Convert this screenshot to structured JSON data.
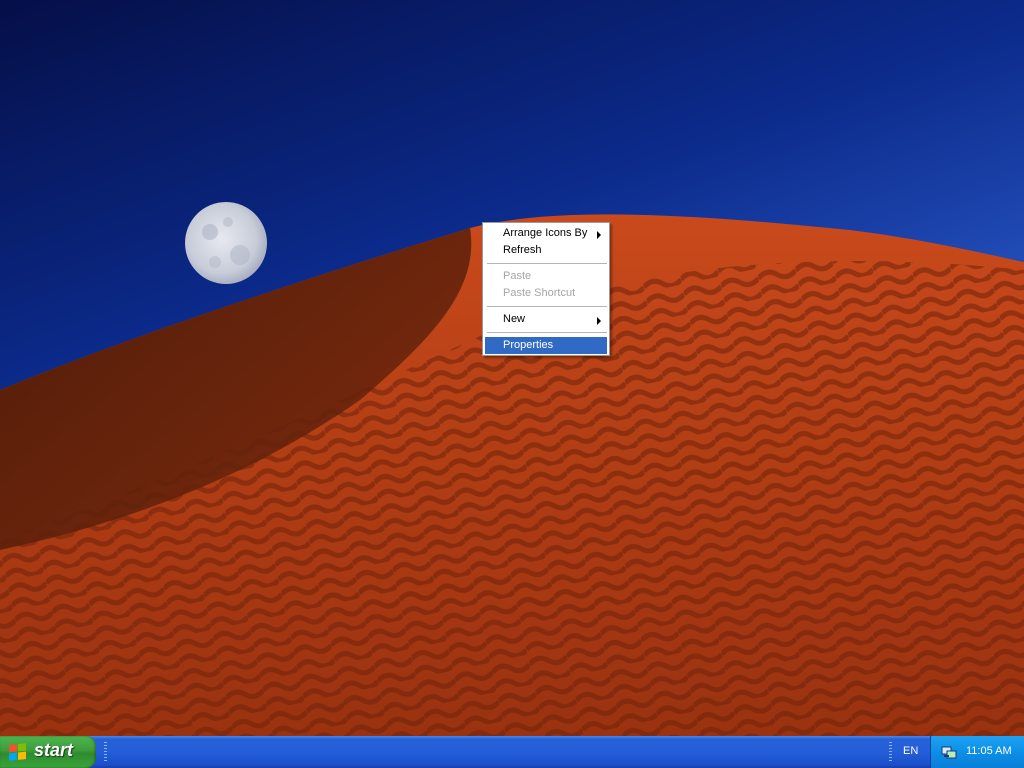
{
  "context_menu": {
    "items": [
      {
        "label": "Arrange Icons By",
        "submenu": true,
        "disabled": false
      },
      {
        "label": "Refresh",
        "submenu": false,
        "disabled": false
      },
      {
        "label": "Paste",
        "submenu": false,
        "disabled": true
      },
      {
        "label": "Paste Shortcut",
        "submenu": false,
        "disabled": true
      },
      {
        "label": "New",
        "submenu": true,
        "disabled": false
      },
      {
        "label": "Properties",
        "submenu": false,
        "disabled": false,
        "selected": true
      }
    ]
  },
  "taskbar": {
    "start_label": "start",
    "language": "EN",
    "clock": "11:05 AM"
  },
  "colors": {
    "menu_highlight": "#316ac5",
    "taskbar_blue": "#245edb",
    "start_green": "#3c9c3c",
    "tray_blue": "#0c8fe8"
  },
  "icons": {
    "start": "windows-flag-icon",
    "tray": "network-icon"
  }
}
